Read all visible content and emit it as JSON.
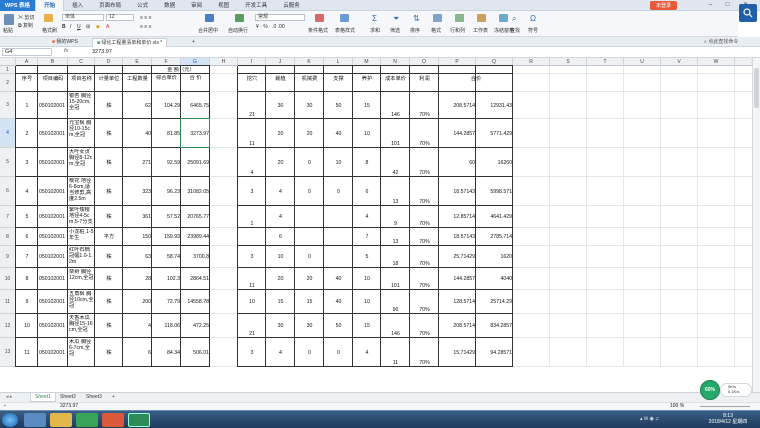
{
  "titlebar": {
    "app_button": "WPS 表格",
    "tabs": [
      "开始",
      "插入",
      "页面布局",
      "公式",
      "数据",
      "审阅",
      "视图",
      "开发工具",
      "云服务"
    ],
    "active_tab": "开始",
    "login_button": "未登录"
  },
  "ribbon": {
    "paste": "粘贴",
    "cut": "剪切",
    "copy": "复制",
    "format_painter": "格式刷",
    "font_name": "宋体",
    "font_size": "12",
    "merge_center": "合并居中",
    "auto_wrap": "自动换行",
    "number_format": "常规",
    "conditional_format": "条件格式",
    "table_style": "表格样式",
    "sum": "求和",
    "filter": "筛选",
    "sort": "排序",
    "format": "格式",
    "rows_cols": "行和列",
    "worksheet": "工作表",
    "freeze": "冻结窗格",
    "find": "查找",
    "symbol": "符号"
  },
  "doc_tabs": {
    "tab1": "我的WPS",
    "tab2": "绿化工程量清单和单价.xls *",
    "new_tab": "+",
    "right_hint": "点此查找命令"
  },
  "formula_bar": {
    "name_box": "G4",
    "fx": "fx",
    "value": "3273.97"
  },
  "columns": [
    "A",
    "B",
    "C",
    "D",
    "E",
    "F",
    "G",
    "H",
    "I",
    "J",
    "K",
    "L",
    "M",
    "N",
    "O",
    "P",
    "Q",
    "R",
    "S",
    "T",
    "U",
    "V",
    "W",
    "X"
  ],
  "row_numbers": [
    "1",
    "2",
    "3",
    "4",
    "5",
    "6",
    "7",
    "8",
    "9",
    "10",
    "11",
    "12",
    "13"
  ],
  "headers": {
    "seq": "序号",
    "code": "项目编码",
    "name": "项目名称",
    "unit": "计量单位",
    "qty": "工程数量",
    "amount_group": "金 额（元）",
    "unit_price": "综合单价",
    "total": "合 价",
    "dig": "挖穴",
    "plant": "栽植",
    "machine": "机械费",
    "support": "支撑",
    "maintain": "养护",
    "cost_price": "成本单价",
    "profit": "利润",
    "total2": "合价"
  },
  "rows": [
    {
      "row": "3",
      "seq": "1",
      "code": "050102001",
      "name": "银杏 胸径15-20cm,全冠",
      "unit": "株",
      "qty": "62",
      "price": "104.29",
      "total": "6465.75",
      "dig": "21",
      "plant": "30",
      "machine": "30",
      "support": "50",
      "maintain": "15",
      "cost": "146",
      "profit": "70%",
      "p": "208.5714",
      "q": "12931.43"
    },
    {
      "row": "4",
      "seq": "2",
      "code": "050102001",
      "name": "元宝枫 胸径10-15cm,全冠",
      "unit": "株",
      "qty": "40",
      "price": "81.85",
      "total": "3273.97",
      "dig": "11",
      "plant": "20",
      "machine": "20",
      "support": "40",
      "maintain": "10",
      "cost": "101",
      "profit": "70%",
      "p": "144.2857",
      "q": "5771.429"
    },
    {
      "row": "5",
      "seq": "3",
      "code": "050102001",
      "name": "大叶女贞 胸径8-12cm,全冠",
      "unit": "株",
      "qty": "271",
      "price": "92.59",
      "total": "25091.69",
      "dig": "4",
      "plant": "20",
      "machine": "0",
      "support": "10",
      "maintain": "8",
      "cost": "42",
      "profit": "70%",
      "p": "60",
      "q": "16260"
    },
    {
      "row": "6",
      "seq": "4",
      "code": "050102001",
      "name": "樱花 地径6-8cm,适当修剪,高度2.5m",
      "unit": "株",
      "qty": "323",
      "price": "96.23",
      "total": "31082.05",
      "dig": "3",
      "plant": "4",
      "machine": "0",
      "support": "0",
      "maintain": "6",
      "cost": "13",
      "profit": "70%",
      "p": "18.57143",
      "q": "5998.571"
    },
    {
      "row": "7",
      "seq": "5",
      "code": "050102001",
      "name": "紫叶矮樱 地径4-5cm,5-7分支",
      "unit": "株",
      "qty": "361",
      "price": "57.52",
      "total": "20765.77",
      "dig": "1",
      "plant": "4",
      "machine": "",
      "support": "",
      "maintain": "4",
      "cost": "9",
      "profit": "70%",
      "p": "12.85714",
      "q": "4641.429"
    },
    {
      "row": "8",
      "seq": "6",
      "code": "050102001",
      "name": "小龙柏 1-5年生",
      "unit": "平方",
      "qty": "150",
      "price": "159.93",
      "total": "23989.44",
      "dig": "",
      "plant": "6",
      "machine": "",
      "support": "",
      "maintain": "7",
      "cost": "13",
      "profit": "70%",
      "p": "18.57143",
      "q": "2785.714"
    },
    {
      "row": "9",
      "seq": "7",
      "code": "050102001",
      "name": "红叶石楠 冠幅1.0-1.2m",
      "unit": "株",
      "qty": "63",
      "price": "58.74",
      "total": "3700.8",
      "dig": "3",
      "plant": "10",
      "machine": "0",
      "support": "",
      "maintain": "5",
      "cost": "18",
      "profit": "70%",
      "p": "25.71429",
      "q": "1620"
    },
    {
      "row": "10",
      "seq": "8",
      "code": "050102001",
      "name": "栾树 胸径12cm,全冠",
      "unit": "株",
      "qty": "28",
      "price": "102.3",
      "total": "2864.51",
      "dig": "11",
      "plant": "20",
      "machine": "20",
      "support": "40",
      "maintain": "10",
      "cost": "101",
      "profit": "70%",
      "p": "144.2857",
      "q": "4040"
    },
    {
      "row": "11",
      "seq": "9",
      "code": "050102001",
      "name": "五角枫 胸径10cm,全冠",
      "unit": "株",
      "qty": "200",
      "price": "72.79",
      "total": "14558.78",
      "dig": "10",
      "plant": "15",
      "machine": "15",
      "support": "40",
      "maintain": "10",
      "cost": "90",
      "profit": "70%",
      "p": "128.5714",
      "q": "25714.29"
    },
    {
      "row": "12",
      "seq": "10",
      "code": "050102001",
      "name": "天香木瓜 胸径15-16cm,全冠",
      "unit": "株",
      "qty": "4",
      "price": "118.06",
      "total": "472.25",
      "dig": "21",
      "plant": "30",
      "machine": "30",
      "support": "50",
      "maintain": "15",
      "cost": "146",
      "profit": "70%",
      "p": "208.5714",
      "q": "834.2857"
    },
    {
      "row": "13",
      "seq": "11",
      "code": "050102001",
      "name": "木瓜 胸径6-7cm,全冠",
      "unit": "株",
      "qty": "6",
      "price": "84.34",
      "total": "506.01",
      "dig": "3",
      "plant": "4",
      "machine": "0",
      "support": "0",
      "maintain": "4",
      "cost": "11",
      "profit": "70%",
      "p": "15.71429",
      "q": "94.28571"
    }
  ],
  "sheet_tabs": [
    "Sheet1",
    "Sheet2",
    "Sheet3"
  ],
  "active_sheet": "Sheet1",
  "status": {
    "cell_value": "3273.97",
    "zoom": "100 %"
  },
  "widget": {
    "percent": "60%",
    "up": "0K/s",
    "down": "0.1K/s"
  },
  "taskbar": {
    "time": "8:13",
    "date": "2018/4/12 星期四"
  },
  "colors": {
    "accent": "#2b7cd3",
    "selection": "#2e8b57",
    "taskbar": "#1e3a5c"
  }
}
